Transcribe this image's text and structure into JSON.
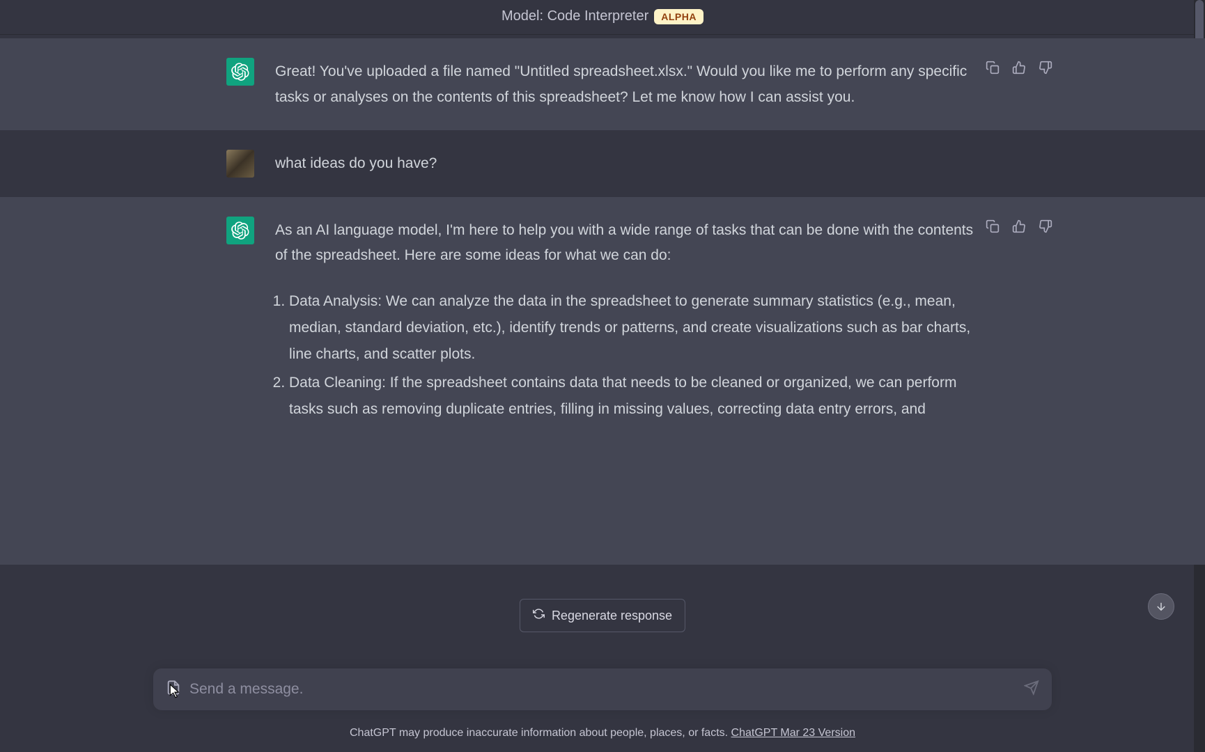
{
  "header": {
    "model_prefix": "Model: ",
    "model_name": "Code Interpreter",
    "badge": "ALPHA"
  },
  "messages": [
    {
      "role": "assistant",
      "text": "Great! You've uploaded a file named \"Untitled spreadsheet.xlsx.\" Would you like me to perform any specific tasks or analyses on the contents of this spreadsheet? Let me know how I can assist you."
    },
    {
      "role": "user",
      "text": "what ideas do you have?"
    },
    {
      "role": "assistant",
      "intro": "As an AI language model, I'm here to help you with a wide range of tasks that can be done with the contents of the spreadsheet. Here are some ideas for what we can do:",
      "list": [
        "Data Analysis: We can analyze the data in the spreadsheet to generate summary statistics (e.g., mean, median, standard deviation, etc.), identify trends or patterns, and create visualizations such as bar charts, line charts, and scatter plots.",
        "Data Cleaning: If the spreadsheet contains data that needs to be cleaned or organized, we can perform tasks such as removing duplicate entries, filling in missing values, correcting data entry errors, and"
      ]
    }
  ],
  "regenerate_label": "Regenerate response",
  "input": {
    "placeholder": "Send a message."
  },
  "footer": {
    "disclaimer": "ChatGPT may produce inaccurate information about people, places, or facts. ",
    "version_link": "ChatGPT Mar 23 Version"
  }
}
